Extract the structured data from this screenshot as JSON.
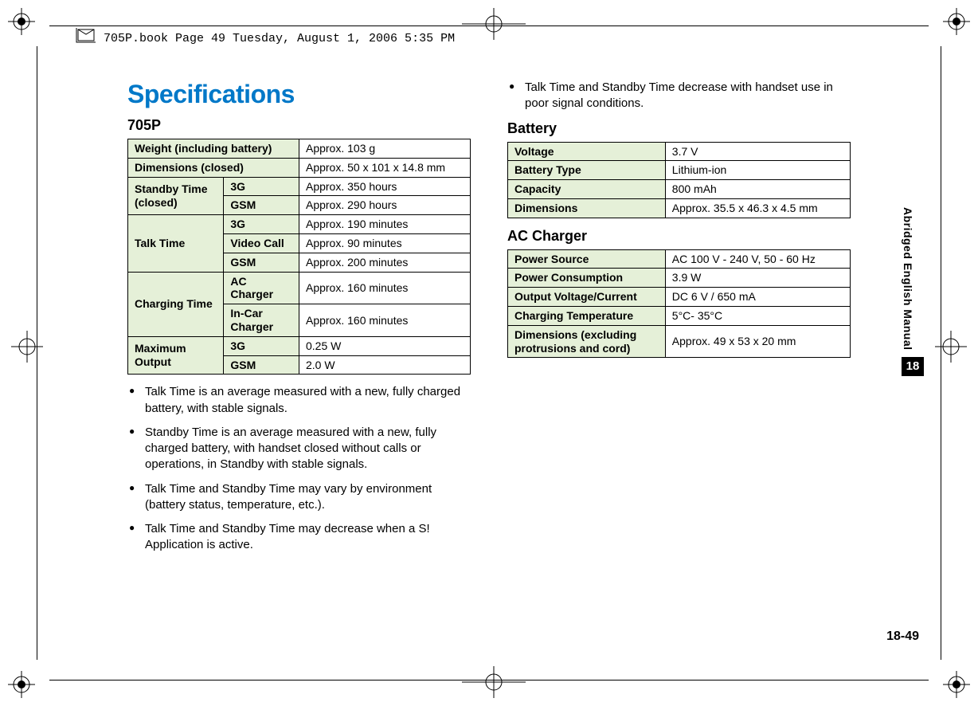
{
  "frame_header": "705P.book  Page 49  Tuesday, August 1, 2006  5:35 PM",
  "main_title": "Specifications",
  "sections": {
    "s705p": {
      "title": "705P",
      "rows": {
        "weight_label": "Weight (including battery)",
        "weight_value": "Approx. 103 g",
        "dims_label": "Dimensions (closed)",
        "dims_value": "Approx. 50 x 101 x 14.8 mm",
        "standby_label": "Standby Time (closed)",
        "standby_3g_l": "3G",
        "standby_3g_v": "Approx. 350 hours",
        "standby_gsm_l": "GSM",
        "standby_gsm_v": "Approx. 290 hours",
        "talk_label": "Talk Time",
        "talk_3g_l": "3G",
        "talk_3g_v": "Approx. 190 minutes",
        "talk_vc_l": "Video Call",
        "talk_vc_v": "Approx. 90 minutes",
        "talk_gsm_l": "GSM",
        "talk_gsm_v": "Approx. 200 minutes",
        "charge_label": "Charging Time",
        "charge_ac_l": "AC Charger",
        "charge_ac_v": "Approx. 160 minutes",
        "charge_incar_l": "In-Car Charger",
        "charge_incar_v": "Approx. 160 minutes",
        "max_label": "Maximum Output",
        "max_3g_l": "3G",
        "max_3g_v": "0.25 W",
        "max_gsm_l": "GSM",
        "max_gsm_v": "2.0 W"
      }
    },
    "battery": {
      "title": "Battery",
      "voltage_l": "Voltage",
      "voltage_v": "3.7 V",
      "type_l": "Battery Type",
      "type_v": "Lithium-ion",
      "cap_l": "Capacity",
      "cap_v": "800 mAh",
      "dims_l": "Dimensions",
      "dims_v": "Approx. 35.5 x 46.3 x 4.5 mm"
    },
    "ac_charger": {
      "title": "AC Charger",
      "ps_l": "Power Source",
      "ps_v": "AC 100 V - 240 V,  50 - 60 Hz",
      "pc_l": "Power Consumption",
      "pc_v": "3.9 W",
      "ov_l": "Output Voltage/Current",
      "ov_v": "DC 6 V / 650 mA",
      "ct_l": "Charging Temperature",
      "ct_v": "5°C- 35°C",
      "dm_l": "Dimensions (excluding protrusions and cord)",
      "dm_v": "Approx. 49 x 53 x 20 mm"
    }
  },
  "notes": {
    "n1": "Talk Time is an average measured with a new, fully charged battery, with stable signals.",
    "n2": "Standby Time is an average measured with a new, fully charged battery, with handset closed without calls or operations, in Standby with stable signals.",
    "n3": "Talk Time and Standby Time may vary by environment (battery status, temperature, etc.).",
    "n4": "Talk Time and Standby Time may decrease when a S! Application is active.",
    "n5": "Talk Time and Standby Time decrease with handset use in poor signal conditions."
  },
  "side_label": "Abridged English Manual",
  "chapter_number": "18",
  "page_number": "18-49"
}
